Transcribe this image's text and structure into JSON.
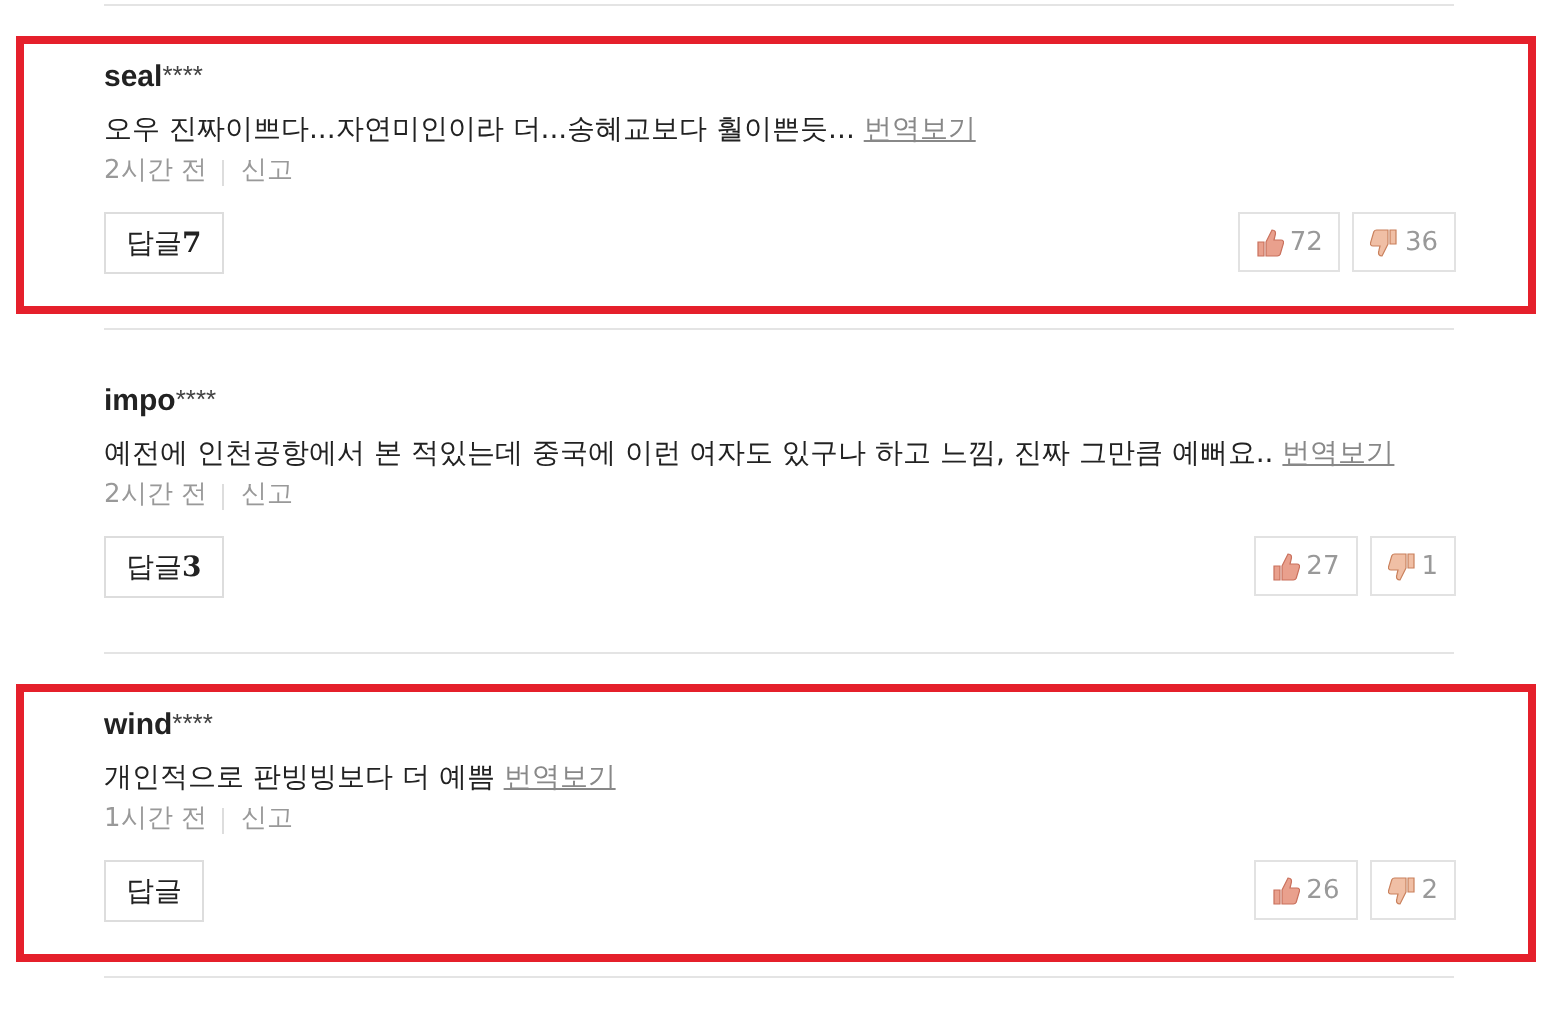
{
  "comments": [
    {
      "user": "seal",
      "mask": "****",
      "text": "오우 진짜이쁘다...자연미인이라 더...송혜교보다 훨이쁜듯...",
      "translate": "번역보기",
      "time": "2시간 전",
      "report": "신고",
      "reply_label": "답글",
      "reply_count": "7",
      "likes": "72",
      "dislikes": "36",
      "highlighted": true
    },
    {
      "user": "impo",
      "mask": "****",
      "text": "예전에 인천공항에서 본 적있는데 중국에 이런 여자도 있구나 하고 느낌, 진짜 그만큼 예뻐요..",
      "translate": "번역보기",
      "time": "2시간 전",
      "report": "신고",
      "reply_label": "답글",
      "reply_count": "3",
      "likes": "27",
      "dislikes": "1",
      "highlighted": false
    },
    {
      "user": "wind",
      "mask": "****",
      "text": "개인적으로 판빙빙보다 더 예쁨",
      "translate": "번역보기",
      "time": "1시간 전",
      "report": "신고",
      "reply_label": "답글",
      "likes": "26",
      "dislikes": "2",
      "highlighted": true
    }
  ]
}
